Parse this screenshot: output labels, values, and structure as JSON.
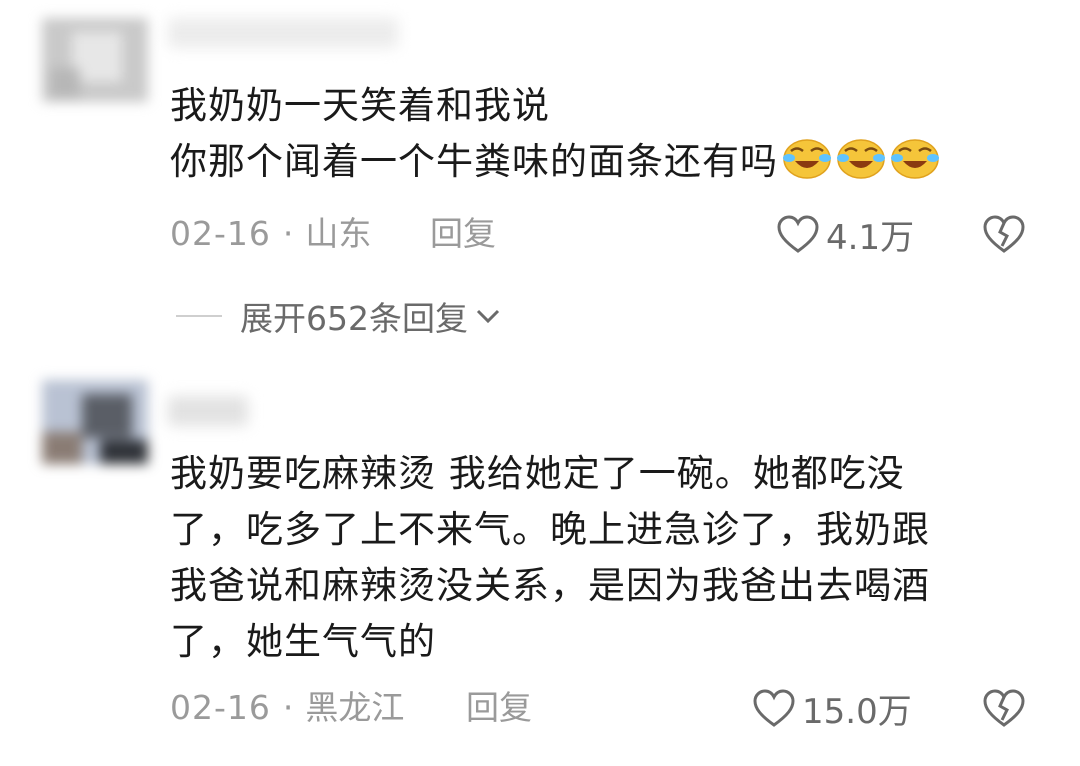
{
  "comments": [
    {
      "text": "我奶奶一天笑着和我说\n你那个闻着一个牛粪味的面条还有吗",
      "emojis": [
        "crying-laughing-icon",
        "crying-laughing-icon",
        "crying-laughing-icon"
      ],
      "date": "02-16",
      "location": "山东",
      "reply_label": "回复",
      "likes": "4.1万"
    },
    {
      "text": "我奶要吃麻辣烫 我给她定了一碗。她都吃没\n了，吃多了上不来气。晚上进急诊了，我奶跟\n我爸说和麻辣烫没关系，是因为我爸出去喝酒\n了，她生气气的",
      "date": "02-16",
      "location": "黑龙江",
      "reply_label": "回复",
      "likes": "15.0万"
    }
  ],
  "expand_replies": "展开652条回复",
  "colors": {
    "text": "#1a1a1a",
    "meta": "#9a9a9a",
    "icon": "#6a6a6a"
  }
}
